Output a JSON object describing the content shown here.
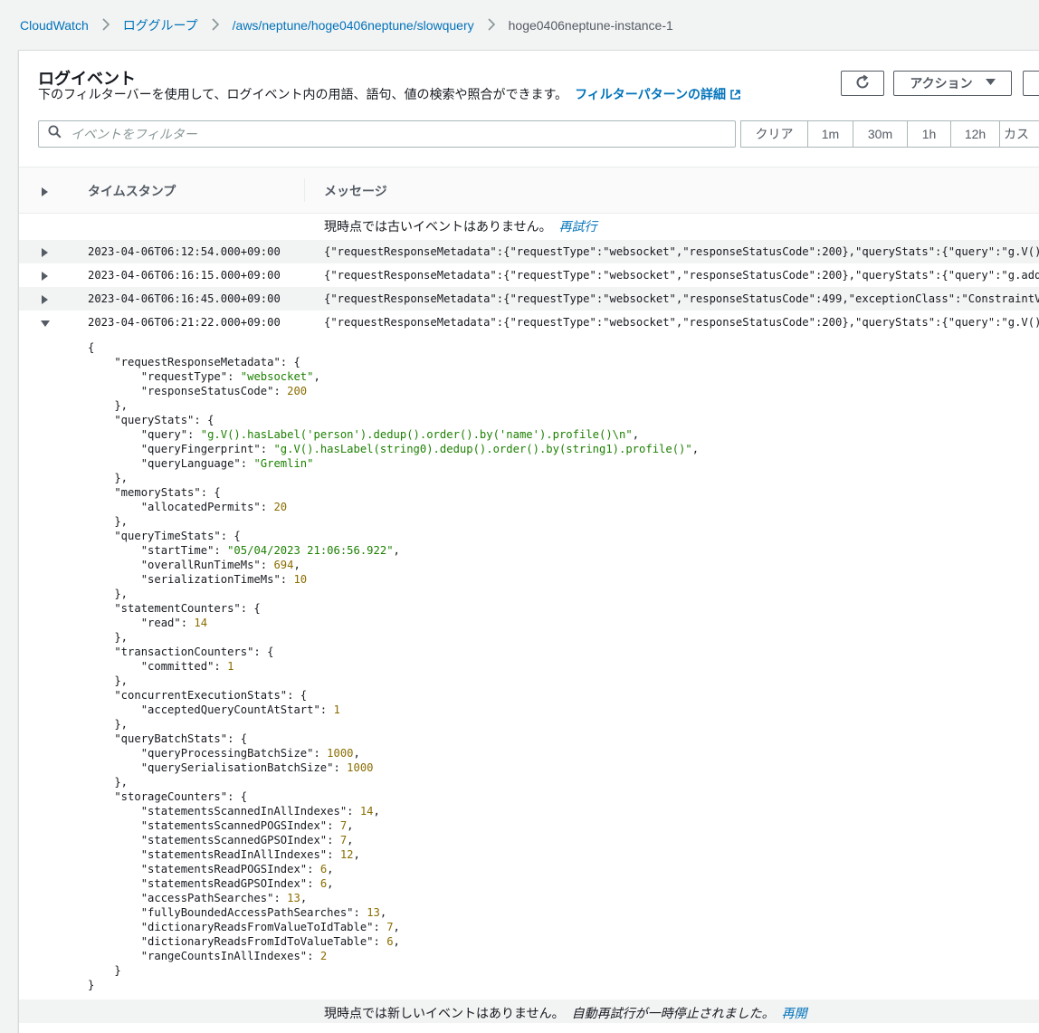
{
  "breadcrumb": {
    "items": [
      "CloudWatch",
      "ロググループ",
      "/aws/neptune/hoge0406neptune/slowquery"
    ],
    "current": "hoge0406neptune-instance-1"
  },
  "panel": {
    "title": "ログイベント",
    "description": "下のフィルターバーを使用して、ログイベント内の用語、語句、値の検索や照合ができます。",
    "description_link": "フィルターパターンの詳細",
    "action_label": "アクション"
  },
  "filter": {
    "placeholder": "イベントをフィルター",
    "value": ""
  },
  "time_range": [
    "クリア",
    "1m",
    "30m",
    "1h",
    "12h",
    "カス"
  ],
  "table": {
    "col_timestamp": "タイムスタンプ",
    "col_message": "メッセージ",
    "no_older": "現時点では古いイベントはありません。",
    "retry": "再試行",
    "rows": [
      {
        "timestamp": "2023-04-06T06:12:54.000+09:00",
        "message": "{\"requestResponseMetadata\":{\"requestType\":\"websocket\",\"responseStatusCode\":200},\"queryStats\":{\"query\":\"g.V()\\n"
      },
      {
        "timestamp": "2023-04-06T06:16:15.000+09:00",
        "message": "{\"requestResponseMetadata\":{\"requestType\":\"websocket\",\"responseStatusCode\":200},\"queryStats\":{\"query\":\"g.addV("
      },
      {
        "timestamp": "2023-04-06T06:16:45.000+09:00",
        "message": "{\"requestResponseMetadata\":{\"requestType\":\"websocket\",\"responseStatusCode\":499,\"exceptionClass\":\"ConstraintVio"
      },
      {
        "timestamp": "2023-04-06T06:21:22.000+09:00",
        "message": "{\"requestResponseMetadata\":{\"requestType\":\"websocket\",\"responseStatusCode\":200},\"queryStats\":{\"query\":\"g.V().h"
      }
    ],
    "no_newer": "現時点では新しいイベントはありません。",
    "auto_paused": "自動再試行が一時停止されました。",
    "resume": "再開"
  },
  "expanded": {
    "requestResponseMetadata": {
      "requestType": "websocket",
      "responseStatusCode": 200
    },
    "queryStats": {
      "query": "g.V().hasLabel('person').dedup().order().by('name').profile()\\n",
      "queryFingerprint": "g.V().hasLabel(string0).dedup().order().by(string1).profile()",
      "queryLanguage": "Gremlin"
    },
    "memoryStats": {
      "allocatedPermits": 20
    },
    "queryTimeStats": {
      "startTime": "05/04/2023 21:06:56.922",
      "overallRunTimeMs": 694,
      "serializationTimeMs": 10
    },
    "statementCounters": {
      "read": 14
    },
    "transactionCounters": {
      "committed": 1
    },
    "concurrentExecutionStats": {
      "acceptedQueryCountAtStart": 1
    },
    "queryBatchStats": {
      "queryProcessingBatchSize": 1000,
      "querySerialisationBatchSize": 1000
    },
    "storageCounters": {
      "statementsScannedInAllIndexes": 14,
      "statementsScannedPOGSIndex": 7,
      "statementsScannedGPSOIndex": 7,
      "statementsReadInAllIndexes": 12,
      "statementsReadPOGSIndex": 6,
      "statementsReadGPSOIndex": 6,
      "accessPathSearches": 13,
      "fullyBoundedAccessPathSearches": 13,
      "dictionaryReadsFromValueToIdTable": 7,
      "dictionaryReadsFromIdToValueTable": 6,
      "rangeCountsInAllIndexes": 2
    }
  },
  "colors": {
    "link": "#0073bb",
    "string": "#1d8102",
    "number": "#8a6d00"
  },
  "icons": [
    "chevron-right-icon",
    "refresh-icon",
    "caret-down-icon",
    "external-link-icon",
    "search-icon",
    "triangle-right-icon",
    "triangle-down-icon"
  ]
}
